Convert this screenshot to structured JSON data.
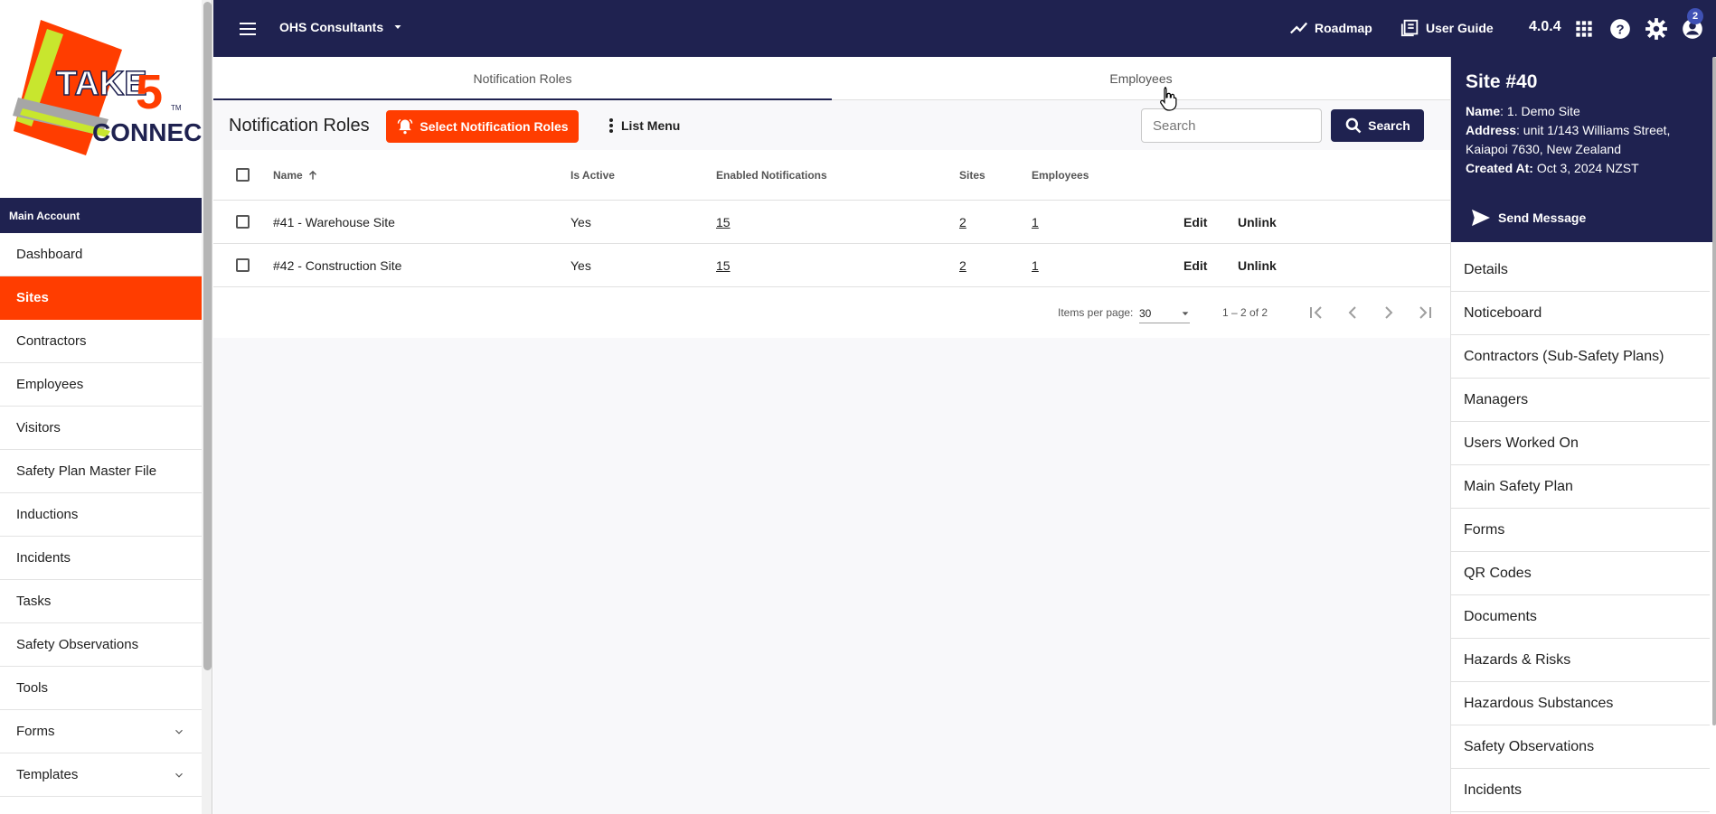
{
  "app": {
    "logo_text_top": "TAKE",
    "logo_text_five": "5",
    "logo_text_bottom": "CONNECT",
    "logo_tm": "TM",
    "brand_colors": {
      "navy": "#1f2250",
      "orange": "#ff3d00"
    }
  },
  "topbar": {
    "org_name": "OHS Consultants",
    "roadmap_label": "Roadmap",
    "user_guide_label": "User Guide",
    "version": "4.0.4",
    "notification_badge": "2",
    "icons": [
      "menu-icon",
      "chevron-down-icon",
      "roadmap-icon",
      "guide-icon",
      "apps-grid-icon",
      "help-icon",
      "settings-icon",
      "account-icon"
    ]
  },
  "sidebar": {
    "account_header": "Main Account",
    "items": [
      {
        "label": "Dashboard",
        "active": false
      },
      {
        "label": "Sites",
        "active": true
      },
      {
        "label": "Contractors",
        "active": false
      },
      {
        "label": "Employees",
        "active": false
      },
      {
        "label": "Visitors",
        "active": false
      },
      {
        "label": "Safety Plan Master File",
        "active": false
      },
      {
        "label": "Inductions",
        "active": false
      },
      {
        "label": "Incidents",
        "active": false
      },
      {
        "label": "Tasks",
        "active": false
      },
      {
        "label": "Safety Observations",
        "active": false
      },
      {
        "label": "Tools",
        "active": false
      },
      {
        "label": "Forms",
        "active": false,
        "expandable": true
      },
      {
        "label": "Templates",
        "active": false,
        "expandable": true
      }
    ]
  },
  "main": {
    "tabs": [
      {
        "label": "Notification Roles",
        "active": true
      },
      {
        "label": "Employees",
        "active": false
      }
    ],
    "title": "Notification Roles",
    "select_button": "Select Notification Roles",
    "list_menu": "List Menu",
    "search": {
      "placeholder": "Search",
      "value": "",
      "button": "Search"
    },
    "table": {
      "columns": [
        "Name",
        "Is Active",
        "Enabled Notifications",
        "Sites",
        "Employees"
      ],
      "sort_column": "Name",
      "rows": [
        {
          "name": "#41 - Warehouse Site",
          "is_active": "Yes",
          "enabled": "15",
          "sites": "2",
          "employees": "1",
          "edit": "Edit",
          "unlink": "Unlink"
        },
        {
          "name": "#42 - Construction Site",
          "is_active": "Yes",
          "enabled": "15",
          "sites": "2",
          "employees": "1",
          "edit": "Edit",
          "unlink": "Unlink"
        }
      ]
    },
    "paginator": {
      "items_per_page_label": "Items per page:",
      "items_per_page": "30",
      "range": "1 – 2 of 2"
    }
  },
  "right_panel": {
    "title": "Site #40",
    "name_label": "Name",
    "name_value": ": 1. Demo Site",
    "address_label": "Address",
    "address_value": ": unit 1/143 Williams Street, Kaiapoi 7630, New Zealand",
    "created_label": "Created At:",
    "created_value": " Oct 3, 2024 NZST",
    "send_message": "Send Message",
    "items": [
      "Details",
      "Noticeboard",
      "Contractors (Sub-Safety Plans)",
      "Managers",
      "Users Worked On",
      "Main Safety Plan",
      "Forms",
      "QR Codes",
      "Documents",
      "Hazards & Risks",
      "Hazardous Substances",
      "Safety Observations",
      "Incidents"
    ]
  }
}
